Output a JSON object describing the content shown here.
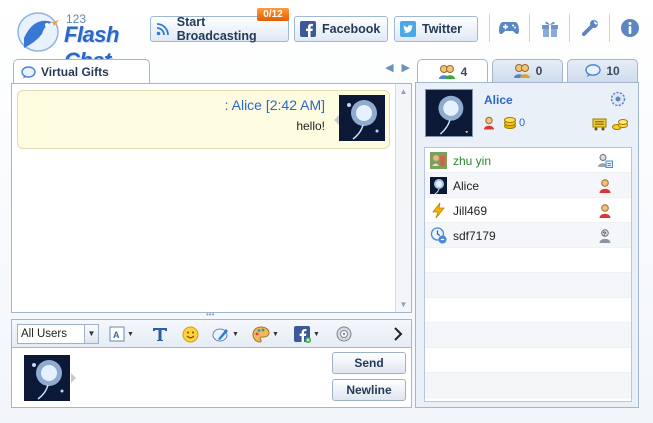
{
  "logo": {
    "number": "123",
    "name": "Flash Chat"
  },
  "toolbar": {
    "broadcast_label": "Start Broadcasting",
    "broadcast_badge": "0/12",
    "facebook_label": "Facebook",
    "twitter_label": "Twitter",
    "icons": [
      "gamepad-icon",
      "gift-icon",
      "wrench-icon",
      "info-icon"
    ]
  },
  "chat": {
    "tab_label": "Virtual Gifts",
    "message": {
      "meta": ": Alice [2:42 AM]",
      "text": "hello!"
    },
    "recipient_select": "All Users",
    "send_label": "Send",
    "newline_label": "Newline"
  },
  "users": {
    "tabs": [
      {
        "icon": "users-icon",
        "count": "4"
      },
      {
        "icon": "group-icon",
        "count": "0"
      },
      {
        "icon": "bubble-icon",
        "count": "10"
      }
    ],
    "me": {
      "name": "Alice",
      "coins": "0"
    },
    "list": [
      {
        "name": "zhu yin",
        "highlight": true
      },
      {
        "name": "Alice",
        "highlight": false
      },
      {
        "name": "Jill469",
        "highlight": false
      },
      {
        "name": "sdf7179",
        "highlight": false
      }
    ]
  },
  "colors": {
    "accent": "#2c67c8",
    "border": "#a3b6cd",
    "badge": "#e35d00"
  }
}
